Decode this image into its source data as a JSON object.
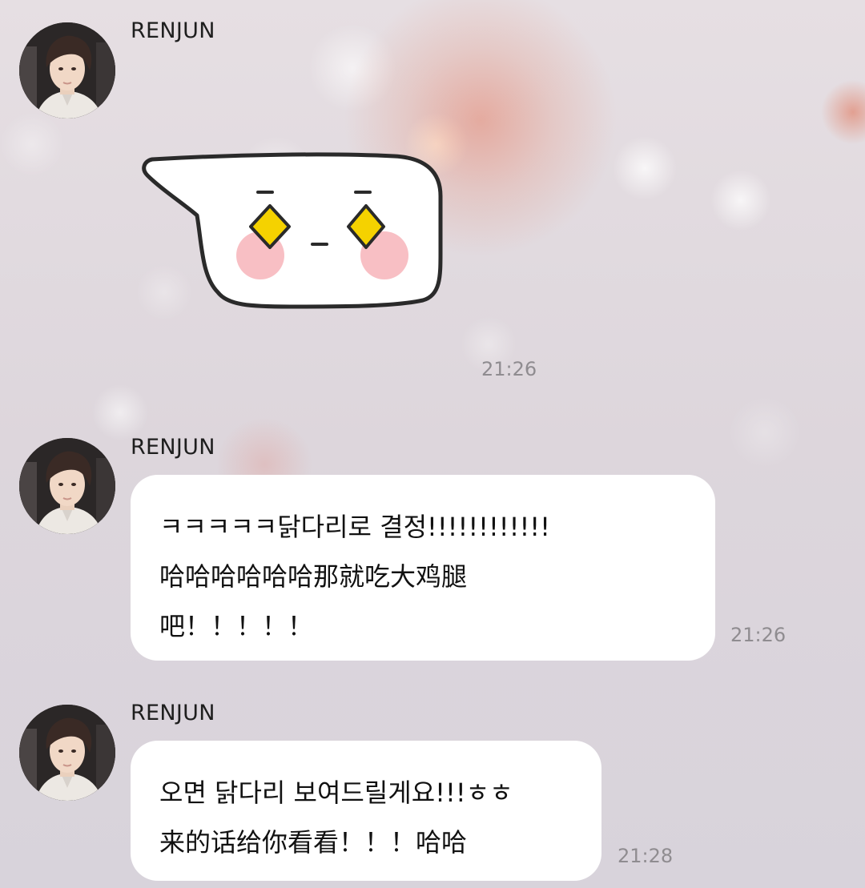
{
  "messages": [
    {
      "sender": "RENJUN",
      "type": "sticker",
      "sticker": "sparkle-eyes-blushing-speech-bubble",
      "time": "21:26"
    },
    {
      "sender": "RENJUN",
      "type": "text",
      "lines": [
        "ㅋㅋㅋㅋㅋ닭다리로 결정!!!!!!!!!!!!",
        "哈哈哈哈哈哈那就吃大鸡腿",
        "吧！！！！！"
      ],
      "time": "21:26"
    },
    {
      "sender": "RENJUN",
      "type": "text",
      "lines": [
        "오면 닭다리 보여드릴게요!!!ㅎㅎ",
        "来的话给你看看！！！哈哈"
      ],
      "time": "21:28"
    }
  ],
  "colors": {
    "bubble": "#ffffff",
    "name_text": "#1e1e1e",
    "timestamp_text": "#8f8c90",
    "sticker_eyes": "#f5d200",
    "sticker_blush": "#f7b8be"
  }
}
